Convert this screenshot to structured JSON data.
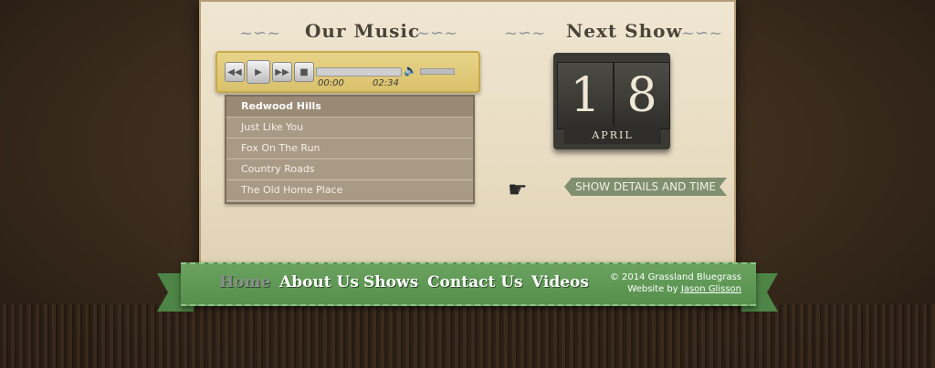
{
  "music": {
    "title": "Our Music",
    "player": {
      "current_time": "00:00",
      "duration": "02:34",
      "progress": 0.0
    },
    "playlist": [
      {
        "title": "Redwood Hills",
        "active": true
      },
      {
        "title": "Just Like You",
        "active": false
      },
      {
        "title": "Fox On The Run",
        "active": false
      },
      {
        "title": "Country Roads",
        "active": false
      },
      {
        "title": "The Old Home Place",
        "active": false
      }
    ]
  },
  "show": {
    "title": "Next Show",
    "day": "18",
    "month": "APRIL",
    "details_label": "SHOW DETAILS AND TIME"
  },
  "nav": {
    "items": [
      "Home",
      "About Us",
      "Shows",
      "Contact Us",
      "Videos"
    ],
    "active": "Home"
  },
  "footer": {
    "copyright": "© 2014 Grassland Bluegrass",
    "credit_prefix": "Website by",
    "credit_name": "Jason Glisson"
  },
  "colors": {
    "ribbon": "#5f9a55",
    "panel": "#e8dcc2",
    "accent": "#d9c06a"
  }
}
